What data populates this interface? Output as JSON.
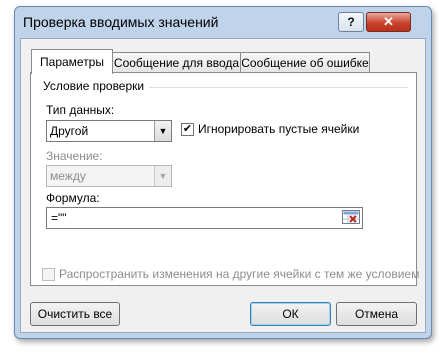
{
  "window": {
    "title": "Проверка вводимых значений",
    "help_label": "?",
    "close_label": "✕"
  },
  "tabs": [
    {
      "label": "Параметры",
      "active": true
    },
    {
      "label": "Сообщение для ввода",
      "active": false
    },
    {
      "label": "Сообщение об ошибке",
      "active": false
    }
  ],
  "validation": {
    "group_title": "Условие проверки",
    "data_type_label": "Тип данных:",
    "data_type_value": "Другой",
    "ignore_blank_label": "Игнорировать пустые ячейки",
    "ignore_blank_checked": true,
    "operator_label": "Значение:",
    "operator_value": "между",
    "operator_enabled": false,
    "formula_label": "Формула:",
    "formula_value": "=\"\"",
    "apply_all_label": "Распространить изменения на другие ячейки с тем же условием",
    "apply_all_checked": false,
    "apply_all_enabled": false
  },
  "buttons": {
    "clear_all": "Очистить все",
    "ok": "ОК",
    "cancel": "Отмена"
  },
  "icons": {
    "combo_arrow": "▼",
    "check": "✔",
    "collapse_dialog": "collapse-dialog-icon"
  },
  "colors": {
    "title_bar": "#bfd3ea",
    "close_button": "#c8432e",
    "client_background": "#f0f0f0",
    "default_button_border": "#3c7fb1"
  }
}
